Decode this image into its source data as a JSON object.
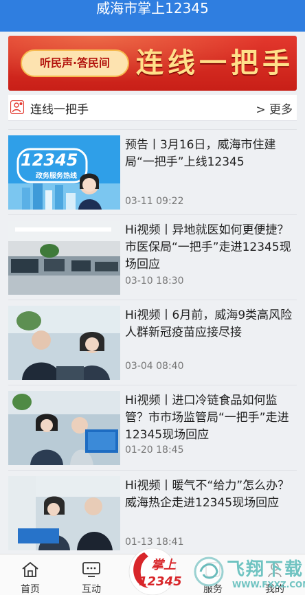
{
  "header": {
    "title": "威海市掌上12345"
  },
  "banner": {
    "pill_text": "听民声·答民间",
    "big_text": "连线一把手"
  },
  "section": {
    "title": "连线一把手",
    "more": "> 更多"
  },
  "articles": [
    {
      "headline": "预告丨3月16日，威海市住建局“一把手”上线12345",
      "date": "03-11 09:22",
      "thumb_text": "12345",
      "thumb_sub": "政务服务热线"
    },
    {
      "headline": "Hi视频丨异地就医如何更便捷？市医保局“一把手”走进12345现场回应",
      "date": "03-10 18:30"
    },
    {
      "headline": "Hi视频丨6月前，威海9类高风险人群新冠疫苗应接尽接",
      "date": "03-04 08:40"
    },
    {
      "headline": "Hi视频丨进口冷链食品如何监管？市市场监管局“一把手”走进12345现场回应",
      "date": "01-20 18:45"
    },
    {
      "headline": "Hi视频丨暖气不“给力”怎么办？威海热企走进12345现场回应",
      "date": "01-13 18:41"
    }
  ],
  "tabs": [
    {
      "label": "首页",
      "icon": "home-icon"
    },
    {
      "label": "互动",
      "icon": "chat-tv-icon"
    },
    {
      "label": "服务",
      "icon": "service-icon"
    },
    {
      "label": "我的",
      "icon": "user-icon"
    }
  ],
  "center_logo": {
    "top": "掌上",
    "bottom": "12345"
  },
  "watermark": {
    "text": "飞翔下载",
    "url": "WWW.FXXZ.COM"
  }
}
